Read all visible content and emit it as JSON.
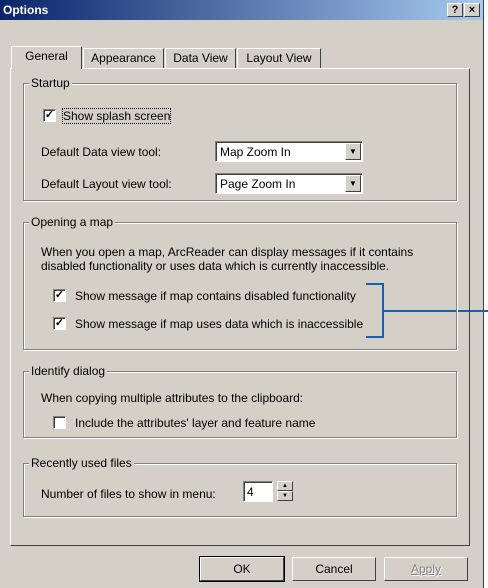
{
  "window": {
    "title": "Options",
    "help_btn": "?",
    "close_btn": "×"
  },
  "tabs": [
    {
      "label": "General",
      "active": true
    },
    {
      "label": "Appearance",
      "active": false
    },
    {
      "label": "Data View",
      "active": false
    },
    {
      "label": "Layout View",
      "active": false
    }
  ],
  "startup": {
    "label": "Startup",
    "splash": {
      "label": "Show splash screen",
      "checked": true
    },
    "data_tool": {
      "label": "Default Data view tool:",
      "value": "Map Zoom In"
    },
    "layout_tool": {
      "label": "Default Layout view tool:",
      "value": "Page Zoom In"
    }
  },
  "opening": {
    "label": "Opening a map",
    "desc_line1": "When you open a map, ArcReader can display messages if it contains",
    "desc_line2": "disabled functionality or uses data which is currently inaccessible.",
    "opt1": {
      "label": "Show message if map contains disabled functionality",
      "checked": true
    },
    "opt2": {
      "label": "Show message if map uses data which is inaccessible",
      "checked": true
    }
  },
  "identify": {
    "label": "Identify dialog",
    "desc": "When copying multiple attributes to the clipboard:",
    "opt": {
      "label": "Include the attributes' layer and feature name",
      "checked": false
    }
  },
  "recent": {
    "label": "Recently used files",
    "count_label": "Number of files to show in menu:",
    "count_value": "4"
  },
  "buttons": {
    "ok": "OK",
    "cancel": "Cancel",
    "apply": "Apply"
  },
  "colors": {
    "callout": "#1a5fb4",
    "title_start": "#0a246a",
    "title_end": "#a6caf0",
    "face": "#d4d0c8"
  },
  "check_glyph": "✓"
}
